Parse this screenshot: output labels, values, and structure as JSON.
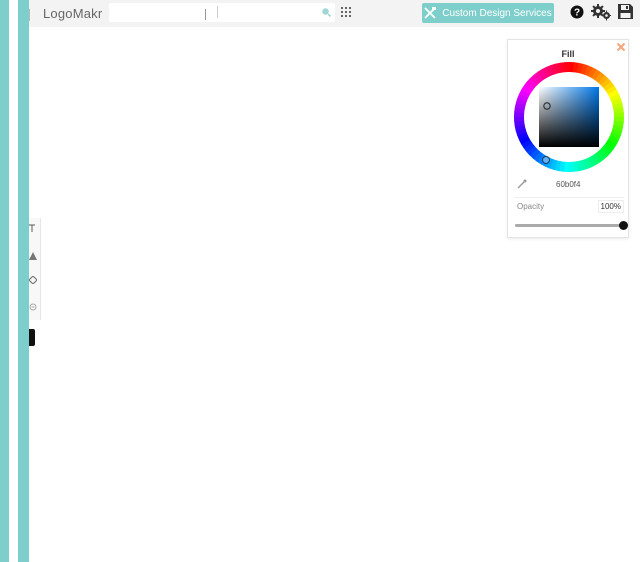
{
  "app": {
    "brand": "LogoMakr"
  },
  "search": {
    "value": "",
    "placeholder": ""
  },
  "toolbar": {
    "cta_label": "Custom Design Services"
  },
  "icons": {
    "search": "search-icon",
    "apps": "grid-icon",
    "cta": "design-tools-icon",
    "help": "help-icon",
    "settings": "gear-icon",
    "save": "save-icon",
    "close": "close-icon",
    "eyedropper": "eyedropper-icon"
  },
  "fill_panel": {
    "title": "Fill",
    "hex": "60b0f4",
    "opacity_label": "Opacity",
    "opacity_value": "100%",
    "opacity_level": 1.0
  },
  "colors": {
    "accent": "#7ecfcb",
    "topbar": "#f3f3f3",
    "close": "#f4a67c",
    "current_fill": "#60b0f4"
  }
}
